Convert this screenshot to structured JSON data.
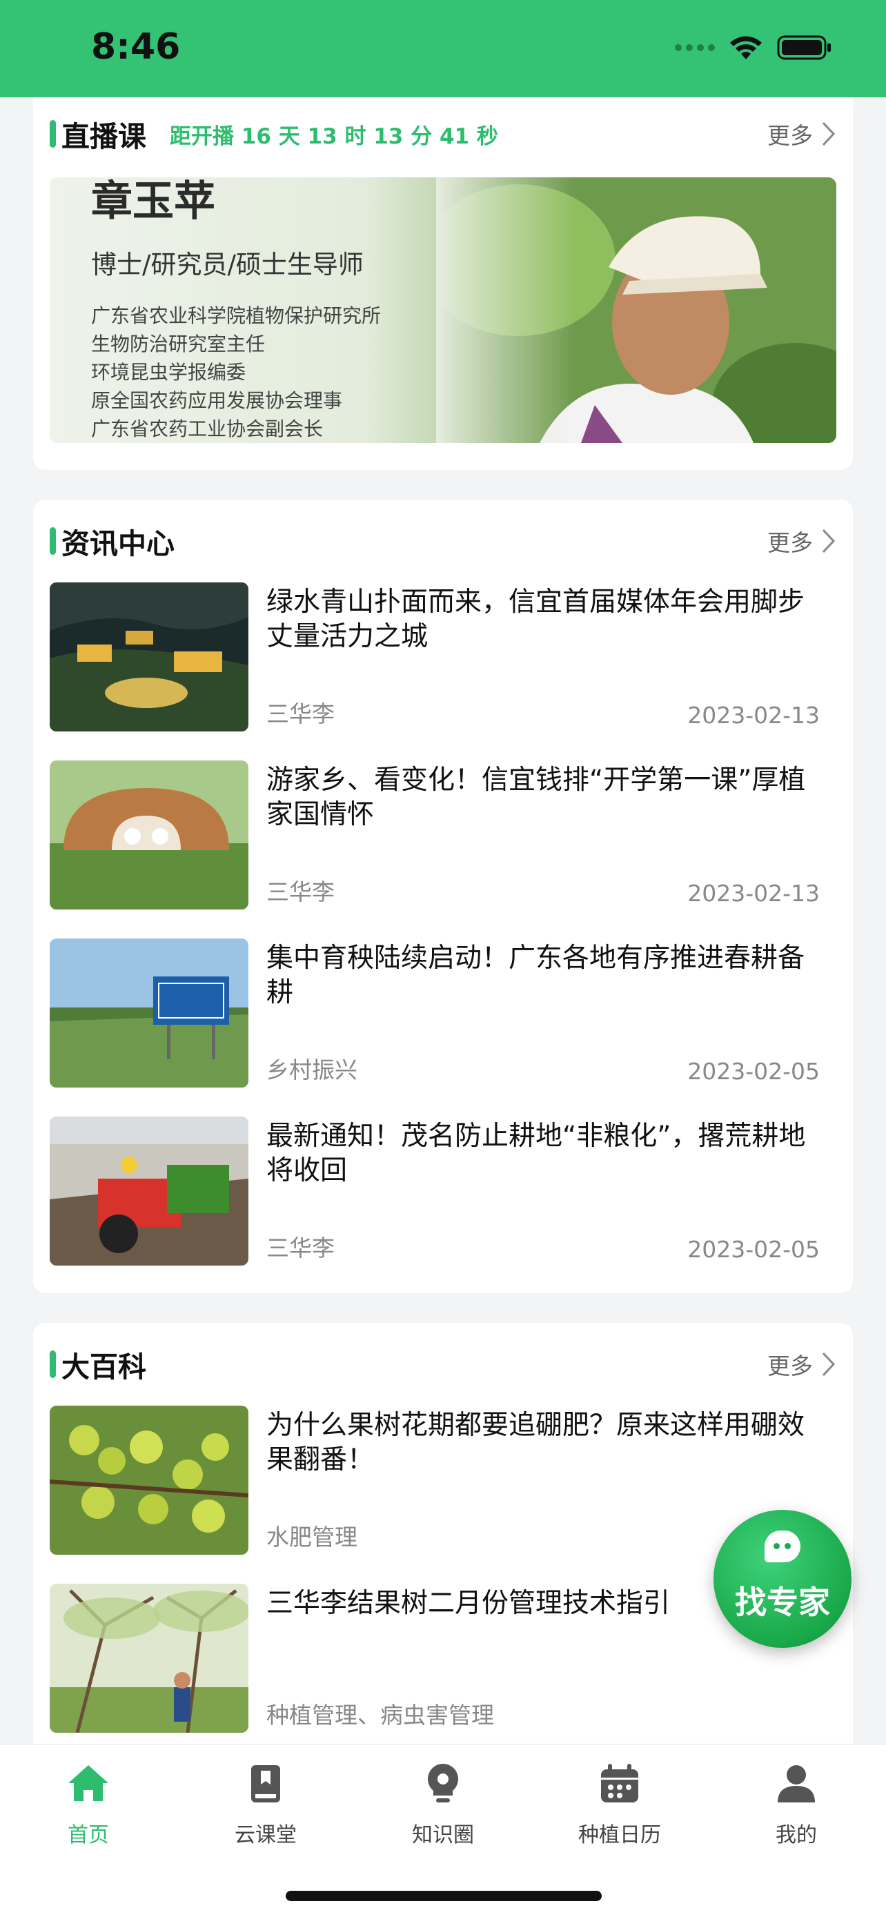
{
  "status_bar": {
    "time": "8:46"
  },
  "live": {
    "title": "直播课",
    "countdown": "距开播 16 天 13 时 13 分 41 秒",
    "more": "更多",
    "banner": {
      "name": "章玉苹",
      "title": "博士/研究员/硕士生导师",
      "lines": [
        "广东省农业科学院植物保护研究所",
        "生物防治研究室主任",
        "环境昆虫学报编委",
        "原全国农药应用发展协会理事",
        "广东省农药工业协会副会长"
      ]
    }
  },
  "news": {
    "title": "资讯中心",
    "more": "更多",
    "items": [
      {
        "title": "绿水青山扑面而来，信宜首届媒体年会用脚步丈量活力之城",
        "source": "三华李",
        "date": "2023-02-13"
      },
      {
        "title": "游家乡、看变化！信宜钱排“开学第一课”厚植家国情怀",
        "source": "三华李",
        "date": "2023-02-13"
      },
      {
        "title": "集中育秧陆续启动！广东各地有序推进春耕备耕",
        "source": "乡村振兴",
        "date": "2023-02-05"
      },
      {
        "title": "最新通知！茂名防止耕地“非粮化”，撂荒耕地将收回",
        "source": "三华李",
        "date": "2023-02-05"
      }
    ]
  },
  "encyclopedia": {
    "title": "大百科",
    "more": "更多",
    "items": [
      {
        "title": "为什么果树花期都要追硼肥？原来这样用硼效果翻番！",
        "tags": "水肥管理"
      },
      {
        "title": "三华李结果树二月份管理技术指引",
        "tags": "种植管理、病虫害管理"
      }
    ]
  },
  "fab": {
    "label": "找专家"
  },
  "tabbar": {
    "tabs": [
      {
        "label": "首页",
        "icon": "home-icon",
        "active": true
      },
      {
        "label": "云课堂",
        "icon": "book-icon",
        "active": false
      },
      {
        "label": "知识圈",
        "icon": "bulb-icon",
        "active": false
      },
      {
        "label": "种植日历",
        "icon": "calendar-icon",
        "active": false
      },
      {
        "label": "我的",
        "icon": "user-icon",
        "active": false
      }
    ]
  },
  "colors": {
    "accent": "#2dbd6e",
    "status_bar": "#34c374"
  }
}
